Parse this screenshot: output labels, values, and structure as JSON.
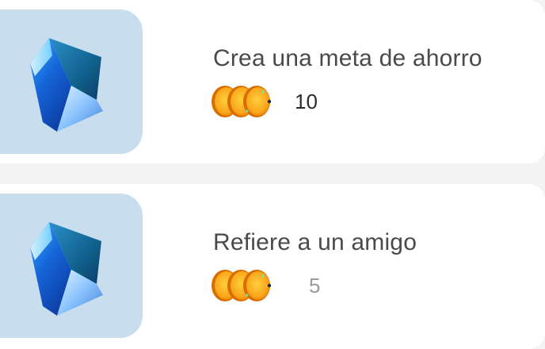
{
  "missions": [
    {
      "title": "Crea una meta de ahorro",
      "reward": "10",
      "reward_icon": "coin-stack-icon",
      "thumbnail_icon": "blue-gem-icon"
    },
    {
      "title": "Refiere a un amigo",
      "reward": "5",
      "reward_icon": "coin-stack-icon",
      "thumbnail_icon": "blue-gem-icon"
    }
  ],
  "colors": {
    "background": "#f3f3f3",
    "card": "#ffffff",
    "thumbnail_bg": "#c8ddee",
    "title_text": "#4a4a4a",
    "reward_text_active": "#2b2b2b",
    "reward_text_muted": "#9a9a9a",
    "coin_gold": "#f6a31b"
  }
}
